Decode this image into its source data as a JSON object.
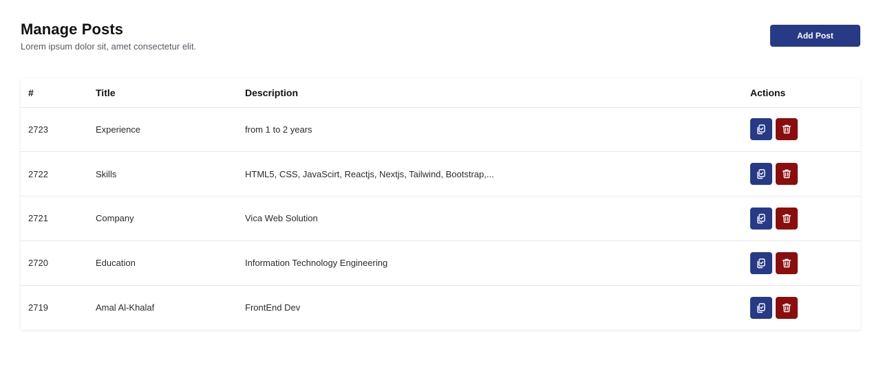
{
  "header": {
    "title": "Manage Posts",
    "subtitle": "Lorem ipsum dolor sit, amet consectetur elit.",
    "add_button_label": "Add Post"
  },
  "table": {
    "columns": [
      "#",
      "Title",
      "Description",
      "Actions"
    ],
    "rows": [
      {
        "id": "2723",
        "title": "Experience",
        "description": "from 1 to 2 years"
      },
      {
        "id": "2722",
        "title": "Skills",
        "description": "HTML5, CSS, JavaScirt, Reactjs, Nextjs, Tailwind, Bootstrap,..."
      },
      {
        "id": "2721",
        "title": "Company",
        "description": "Vica Web Solution"
      },
      {
        "id": "2720",
        "title": "Education",
        "description": "Information Technology Engineering"
      },
      {
        "id": "2719",
        "title": "Amal Al-Khalaf",
        "description": "FrontEnd Dev"
      }
    ],
    "row_actions": [
      {
        "icon": "copy-icon",
        "color": "#263a85"
      },
      {
        "icon": "trash-icon",
        "color": "#8b0d0d"
      }
    ]
  },
  "colors": {
    "primary": "#263a85",
    "danger": "#8b0d0d"
  }
}
